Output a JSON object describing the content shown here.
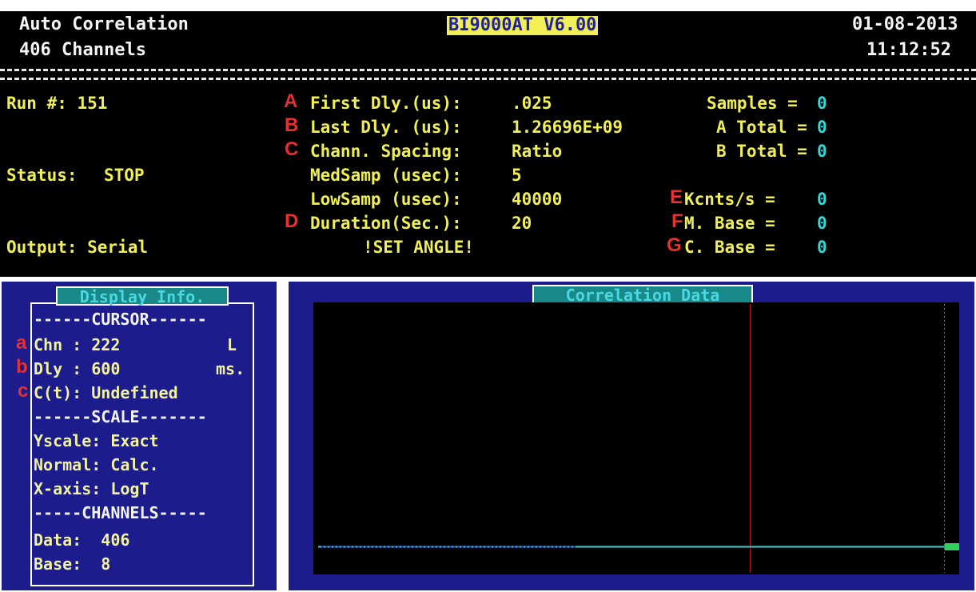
{
  "header": {
    "left_line1": "Auto Correlation",
    "left_line2": "406 Channels",
    "center_title": "BI9000AT V6.00",
    "date": "01-08-2013",
    "time": "11:12:52"
  },
  "run": {
    "run_label": "Run #: 151",
    "status_label": "Status:",
    "status_value": "STOP",
    "output_label": "Output: Serial"
  },
  "params": [
    {
      "marker": "A",
      "label": "First Dly.(us):",
      "value": ".025"
    },
    {
      "marker": "B",
      "label": "Last Dly. (us):",
      "value": "1.26696E+09"
    },
    {
      "marker": "C",
      "label": "Chann. Spacing:",
      "value": "Ratio"
    },
    {
      "marker": "",
      "label": "MedSamp (usec):",
      "value": "5"
    },
    {
      "marker": "",
      "label": "LowSamp (usec):",
      "value": "40000"
    },
    {
      "marker": "D",
      "label": "Duration(Sec.):",
      "value": "20"
    }
  ],
  "set_angle": "!SET ANGLE!",
  "stats": [
    {
      "marker": "",
      "label": "Samples =",
      "value": "0"
    },
    {
      "marker": "",
      "label": "A Total =",
      "value": "0"
    },
    {
      "marker": "",
      "label": "B Total =",
      "value": "0"
    },
    {
      "marker": "E",
      "label": "Kcnts/s =",
      "value": "0"
    },
    {
      "marker": "F",
      "label": "M. Base =",
      "value": "0"
    },
    {
      "marker": "G",
      "label": "C. Base =",
      "value": "0"
    }
  ],
  "display_info": {
    "title": "Display  Info.",
    "cursor_header": "------CURSOR------",
    "chn_marker": "a",
    "chn_line": "Chn : 222",
    "chn_flag": "L",
    "dly_marker": "b",
    "dly_line": "Dly : 600",
    "dly_unit": "ms.",
    "ct_marker": "c",
    "ct_line": "C(t): Undefined",
    "scale_header": "------SCALE-------",
    "yscale": "Yscale: Exact",
    "normal": "Normal: Calc.",
    "xaxis": "X-axis: LogT",
    "channels_header": "-----CHANNELS-----",
    "data_line": "Data:  406",
    "base_line": "Base:  8"
  },
  "correlation": {
    "title": "Correlation Data",
    "baseline_color": "#40d0d0",
    "cursor_color": "#b01818",
    "end_marker_color": "#30d060"
  }
}
